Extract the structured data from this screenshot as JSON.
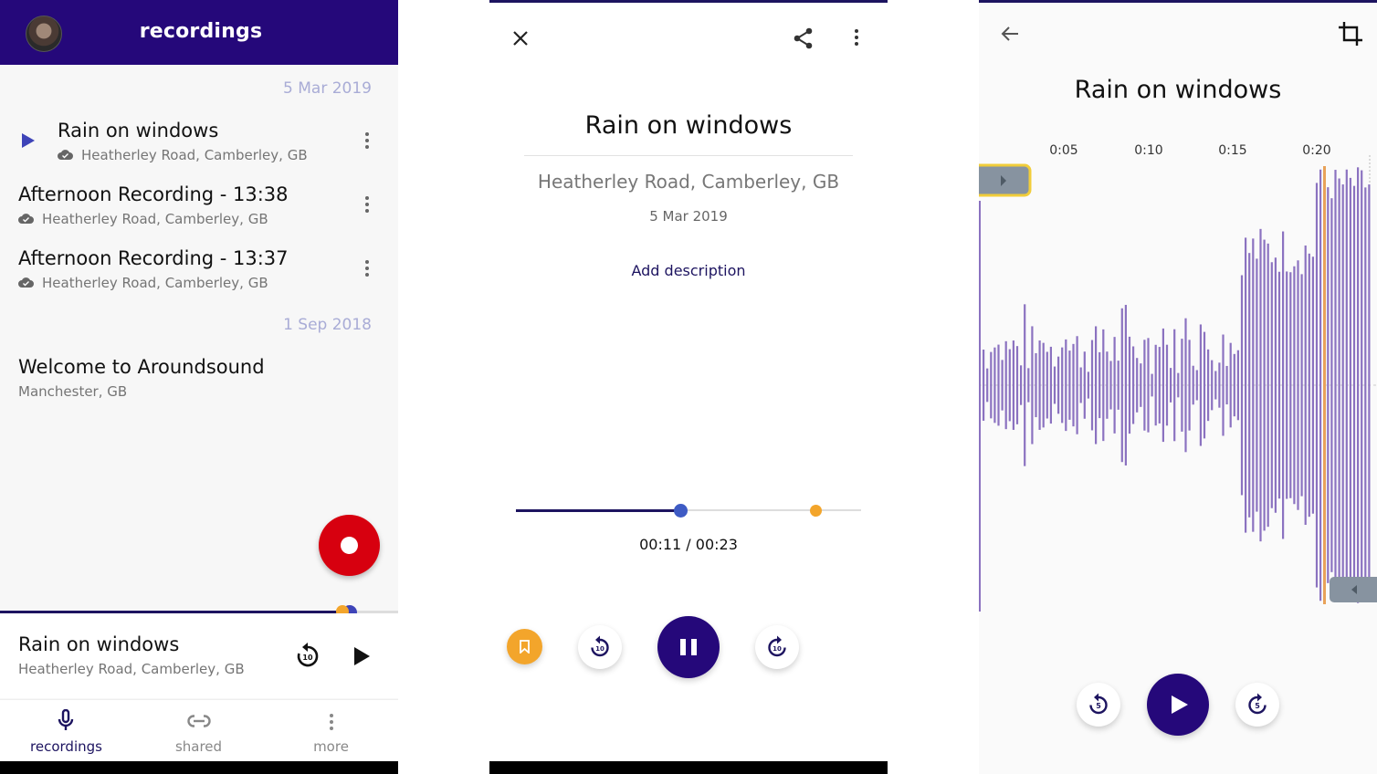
{
  "colors": {
    "primary": "#25087a",
    "accent_blue": "#3e44b8",
    "bookmark_orange": "#f3a52b",
    "record_red": "#d7000f",
    "waveform": "#8b72c0",
    "date_header": "#a9acd6"
  },
  "list_screen": {
    "appbar": {
      "title": "recordings",
      "avatar": "user-avatar"
    },
    "groups": [
      {
        "date": "5 Mar 2019",
        "items": [
          {
            "title": "Rain on windows",
            "location": "Heatherley Road, Camberley, GB",
            "synced": true,
            "playing": true
          },
          {
            "title": "Afternoon Recording - 13:38",
            "location": "Heatherley Road, Camberley, GB",
            "synced": true,
            "playing": false
          },
          {
            "title": "Afternoon Recording - 13:37",
            "location": "Heatherley Road, Camberley, GB",
            "synced": true,
            "playing": false
          }
        ]
      },
      {
        "date": "1 Sep 2018",
        "items": [
          {
            "title": "Welcome to Aroundsound",
            "location": "Manchester, GB",
            "synced": false,
            "playing": false
          }
        ]
      }
    ],
    "record_fab_icon": "record-icon",
    "mini_player": {
      "title": "Rain on windows",
      "location": "Heatherley Road, Camberley, GB",
      "progress": 0.87,
      "rewind_label": "10"
    },
    "bottom_nav": [
      {
        "label": "recordings",
        "icon": "mic-icon",
        "active": true
      },
      {
        "label": "shared",
        "icon": "link-icon",
        "active": false
      },
      {
        "label": "more",
        "icon": "more-vert-icon",
        "active": false
      }
    ]
  },
  "player_screen": {
    "title": "Rain on windows",
    "location": "Heatherley Road, Camberley, GB",
    "date": "5 Mar 2019",
    "add_description": "Add description",
    "elapsed": "00:11",
    "total": "00:23",
    "time_display": "00:11 / 00:23",
    "progress": 0.478,
    "bookmark_position": 0.87,
    "rewind_label": "10",
    "forward_label": "10",
    "state": "playing"
  },
  "trim_screen": {
    "title": "Rain on windows",
    "ticks": [
      "0:05",
      "0:10",
      "0:15",
      "0:20"
    ],
    "tick_seconds": [
      5,
      10,
      15,
      20
    ],
    "playhead_seconds": 20.3,
    "rewind_label": "5",
    "forward_label": "5",
    "state": "paused"
  }
}
